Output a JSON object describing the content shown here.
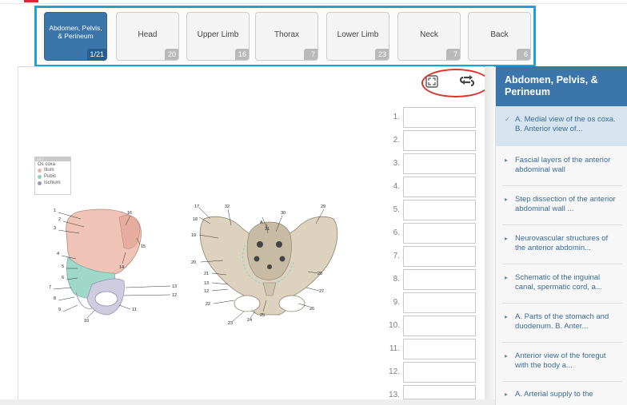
{
  "tabs": [
    {
      "label": "Abdomen, Pelvis, & Perineum",
      "count": "1/21",
      "active": true
    },
    {
      "label": "Head",
      "count": "20"
    },
    {
      "label": "Upper Limb",
      "count": "16"
    },
    {
      "label": "Thorax",
      "count": "7"
    },
    {
      "label": "Lower Limb",
      "count": "23"
    },
    {
      "label": "Neck",
      "count": "7"
    },
    {
      "label": "Back",
      "count": "6"
    }
  ],
  "toolbar": {
    "fullscreen_icon": "fullscreen-icon",
    "swap_icon": "swap-arrows-icon"
  },
  "key": {
    "header": "KEY",
    "title": "Os coxa",
    "items": [
      {
        "label": "Ilium",
        "color": "#e9b5a8"
      },
      {
        "label": "Pubis",
        "color": "#8fd1c3"
      },
      {
        "label": "Ischium",
        "color": "#9b97b8"
      }
    ]
  },
  "left_labels": [
    "1",
    "2",
    "3",
    "4",
    "5",
    "6",
    "7",
    "8",
    "9",
    "10",
    "11",
    "12",
    "13",
    "14",
    "15",
    "16"
  ],
  "right_labels": [
    "17",
    "32",
    "18",
    "19",
    "20",
    "21",
    "13",
    "12",
    "22",
    "23",
    "24",
    "25",
    "26",
    "27",
    "28",
    "29",
    "30",
    "31",
    "A"
  ],
  "answers": [
    "1.",
    "2.",
    "3.",
    "4.",
    "5.",
    "6.",
    "7.",
    "8.",
    "9.",
    "10.",
    "11.",
    "12.",
    "13."
  ],
  "sidebar": {
    "title": "Abdomen, Pelvis, & Perineum",
    "items": [
      {
        "text": "A. Medial view of the os coxa. B. Anterior view of...",
        "active": true
      },
      {
        "text": "Fascial layers of the anterior abdominal wall"
      },
      {
        "text": "Step dissection of the anterior abdominal wall ..."
      },
      {
        "text": "Neurovascular structures of the anterior abdomin..."
      },
      {
        "text": "Schematic of the inguinal canal, spermatic cord, a..."
      },
      {
        "text": "A. Parts of the stomach and duodenum. B. Anter..."
      },
      {
        "text": "Anterior view of the foregut with the body a..."
      },
      {
        "text": "A. Arterial supply to the"
      }
    ]
  }
}
